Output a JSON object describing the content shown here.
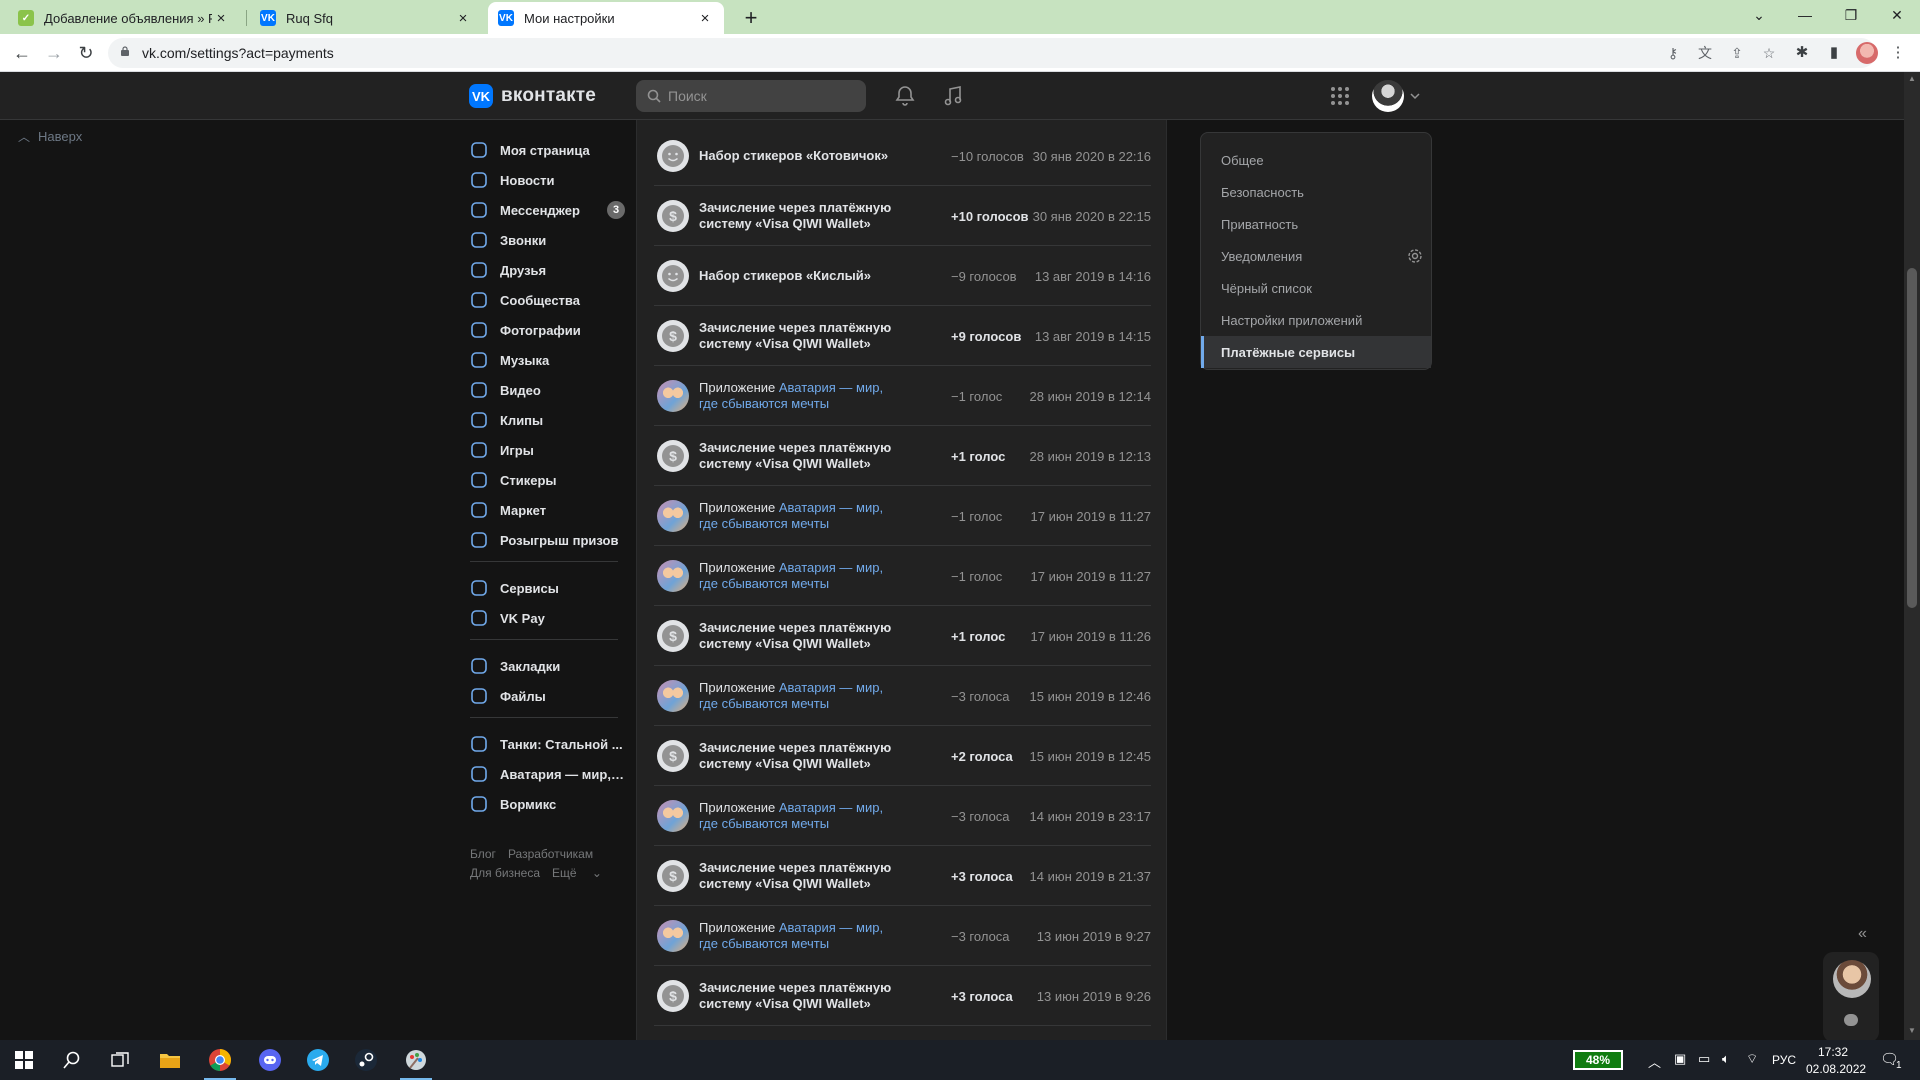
{
  "browser": {
    "tabs": [
      {
        "title": "Добавление объявления » Рын",
        "close": "×"
      },
      {
        "title": "Ruq Sfq",
        "close": "×"
      },
      {
        "title": "Мои настройки",
        "close": "×"
      }
    ],
    "new_tab": "+",
    "url": "vk.com/settings?act=payments",
    "tabbar_color": "#c7e3c0"
  },
  "vk": {
    "brand_color": "#0077ff",
    "logo_text": "вконтакте",
    "search_placeholder": "Поиск",
    "up_link": "Наверх",
    "nav_main": [
      {
        "label": "Моя страница",
        "icon": "user-circle-icon"
      },
      {
        "label": "Новости",
        "icon": "newsfeed-icon"
      },
      {
        "label": "Мессенджер",
        "icon": "message-icon",
        "badge": "3"
      },
      {
        "label": "Звонки",
        "icon": "phone-icon"
      },
      {
        "label": "Друзья",
        "icon": "friends-icon"
      },
      {
        "label": "Сообщества",
        "icon": "communities-icon"
      },
      {
        "label": "Фотографии",
        "icon": "photo-icon"
      },
      {
        "label": "Музыка",
        "icon": "music-icon"
      },
      {
        "label": "Видео",
        "icon": "video-icon"
      },
      {
        "label": "Клипы",
        "icon": "clips-icon"
      },
      {
        "label": "Игры",
        "icon": "gamepad-icon"
      },
      {
        "label": "Стикеры",
        "icon": "sticker-icon"
      },
      {
        "label": "Маркет",
        "icon": "market-icon"
      },
      {
        "label": "Розыгрыш призов",
        "icon": "gift-icon"
      }
    ],
    "nav_services": [
      {
        "label": "Сервисы",
        "icon": "services-icon"
      },
      {
        "label": "VK Pay",
        "icon": "vkpay-icon"
      }
    ],
    "nav_saved": [
      {
        "label": "Закладки",
        "icon": "bookmark-icon"
      },
      {
        "label": "Файлы",
        "icon": "file-icon"
      }
    ],
    "nav_games": [
      {
        "label": "Танки: Стальной ...",
        "icon": "gamepad-icon"
      },
      {
        "label": "Аватария — мир, г...",
        "icon": "gamepad-icon"
      },
      {
        "label": "Вормикс",
        "icon": "gamepad-icon"
      }
    ],
    "footer": {
      "blog": "Блог",
      "dev": "Разработчикам",
      "business": "Для бизнеса",
      "more": "Ещё"
    },
    "transactions": [
      {
        "kind": "sticker",
        "title": "Набор стикеров «Котовичок»",
        "amount": "−10 голосов",
        "date": "30 янв 2020 в 22:16"
      },
      {
        "kind": "topup",
        "title": "Зачисление через платёжную систему «Visa QIWI Wallet»",
        "amount": "+10 голосов",
        "date": "30 янв 2020 в 22:15"
      },
      {
        "kind": "sticker",
        "title": "Набор стикеров «Кислый»",
        "amount": "−9 голосов",
        "date": "13 авг 2019 в 14:16"
      },
      {
        "kind": "topup",
        "title": "Зачисление через платёжную систему «Visa QIWI Wallet»",
        "amount": "+9 голосов",
        "date": "13 авг 2019 в 14:15"
      },
      {
        "kind": "app",
        "prefix": "Приложение",
        "app": "Аватария — мир, где сбываются мечты",
        "amount": "−1 голос",
        "date": "28 июн 2019 в 12:14"
      },
      {
        "kind": "topup",
        "title": "Зачисление через платёжную систему «Visa QIWI Wallet»",
        "amount": "+1 голос",
        "date": "28 июн 2019 в 12:13"
      },
      {
        "kind": "app",
        "prefix": "Приложение",
        "app": "Аватария — мир, где сбываются мечты",
        "amount": "−1 голос",
        "date": "17 июн 2019 в 11:27"
      },
      {
        "kind": "app",
        "prefix": "Приложение",
        "app": "Аватария — мир, где сбываются мечты",
        "amount": "−1 голос",
        "date": "17 июн 2019 в 11:27"
      },
      {
        "kind": "topup",
        "title": "Зачисление через платёжную систему «Visa QIWI Wallet»",
        "amount": "+1 голос",
        "date": "17 июн 2019 в 11:26"
      },
      {
        "kind": "app",
        "prefix": "Приложение",
        "app": "Аватария — мир, где сбываются мечты",
        "amount": "−3 голоса",
        "date": "15 июн 2019 в 12:46"
      },
      {
        "kind": "topup",
        "title": "Зачисление через платёжную систему «Visa QIWI Wallet»",
        "amount": "+2 голоса",
        "date": "15 июн 2019 в 12:45"
      },
      {
        "kind": "app",
        "prefix": "Приложение",
        "app": "Аватария — мир, где сбываются мечты",
        "amount": "−3 голоса",
        "date": "14 июн 2019 в 23:17"
      },
      {
        "kind": "topup",
        "title": "Зачисление через платёжную систему «Visa QIWI Wallet»",
        "amount": "+3 голоса",
        "date": "14 июн 2019 в 21:37"
      },
      {
        "kind": "app",
        "prefix": "Приложение",
        "app": "Аватария — мир, где сбываются мечты",
        "amount": "−3 голоса",
        "date": "13 июн 2019 в 9:27"
      },
      {
        "kind": "topup",
        "title": "Зачисление через платёжную систему «Visa QIWI Wallet»",
        "amount": "+3 голоса",
        "date": "13 июн 2019 в 9:26"
      }
    ],
    "settings_menu": [
      {
        "label": "Общее"
      },
      {
        "label": "Безопасность"
      },
      {
        "label": "Приватность"
      },
      {
        "label": "Уведомления",
        "gear": true
      },
      {
        "label": "Чёрный список"
      },
      {
        "label": "Настройки приложений"
      },
      {
        "label": "Платёжные сервисы",
        "active": true
      }
    ],
    "collapse_icon": "«"
  },
  "taskbar": {
    "battery": "48%",
    "lang": "РУС",
    "time": "17:32",
    "date": "02.08.2022",
    "notifications": "1"
  }
}
